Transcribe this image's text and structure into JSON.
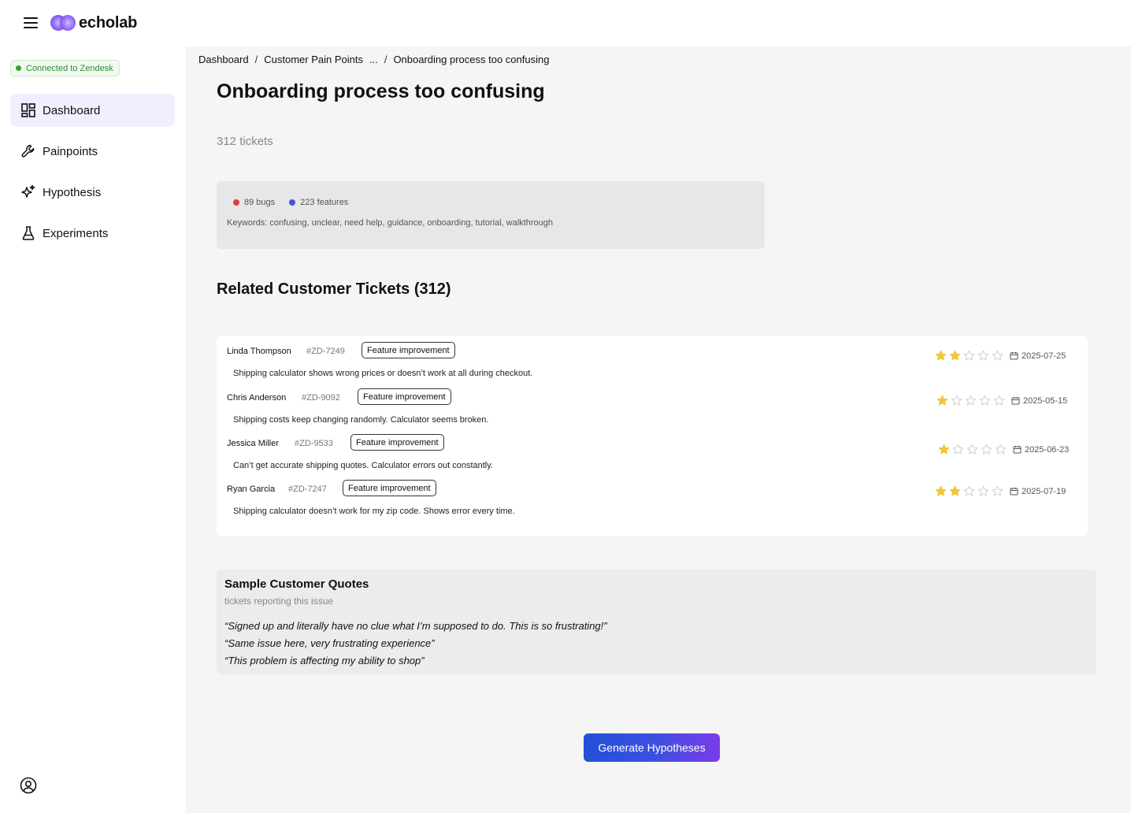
{
  "app": {
    "name": "echolab"
  },
  "sidebar": {
    "connection_status": "Connected to Zendesk",
    "items": [
      {
        "label": "Dashboard",
        "icon": "dashboard-icon",
        "active": true
      },
      {
        "label": "Painpoints",
        "icon": "wrench-icon",
        "active": false
      },
      {
        "label": "Hypothesis",
        "icon": "sparkle-icon",
        "active": false
      },
      {
        "label": "Experiments",
        "icon": "flask-icon",
        "active": false
      }
    ]
  },
  "breadcrumb": {
    "items": [
      "Dashboard",
      "Customer Pain Points",
      "...",
      "Onboarding process too confusing"
    ],
    "separator": "/"
  },
  "page": {
    "title": "Onboarding process too confusing",
    "ticket_count": "312 tickets"
  },
  "summary": {
    "bugs": "89 bugs",
    "features": "223 features",
    "bug_color": "#e03a3a",
    "feature_color": "#4a52d8",
    "keywords": "Keywords: confusing, unclear, need help, guidance, onboarding, tutorial, walkthrough"
  },
  "tickets": {
    "section_title": "Related Customer Tickets (312)",
    "rows": [
      {
        "name": "Linda Thompson",
        "id": "#ZD-7249",
        "tag": "Feature improvement",
        "description": "Shipping calculator shows wrong prices or doesn’t work at all during checkout.",
        "rating": 2,
        "date": "2025-07-25"
      },
      {
        "name": "Chris Anderson",
        "id": "#ZD-9092",
        "tag": "Feature improvement",
        "description": "Shipping costs keep changing randomly. Calculator seems broken.",
        "rating": 1,
        "date": "2025-05-15"
      },
      {
        "name": "Jessica Miller",
        "id": "#ZD-9533",
        "tag": "Feature improvement",
        "description": "Can’t get accurate shipping quotes. Calculator errors out constantly.",
        "rating": 1,
        "date": "2025-06-23"
      },
      {
        "name": "Ryan Garcia",
        "id": "#ZD-7247",
        "tag": "Feature improvement",
        "description": "Shipping calculator doesn’t work for my zip code. Shows error every time.",
        "rating": 2,
        "date": "2025-07-19"
      }
    ],
    "max_rating": 5,
    "star_color": "#f0c53a"
  },
  "quotes": {
    "title": "Sample Customer Quotes",
    "subtitle": "tickets reporting this issue",
    "items": [
      "“Signed up and literally have no clue what I’m supposed to do. This is so frustrating!”",
      "“Same issue here, very frustrating experience”",
      "“This problem is affecting my ability to shop”"
    ]
  },
  "actions": {
    "generate_label": "Generate Hypotheses"
  }
}
